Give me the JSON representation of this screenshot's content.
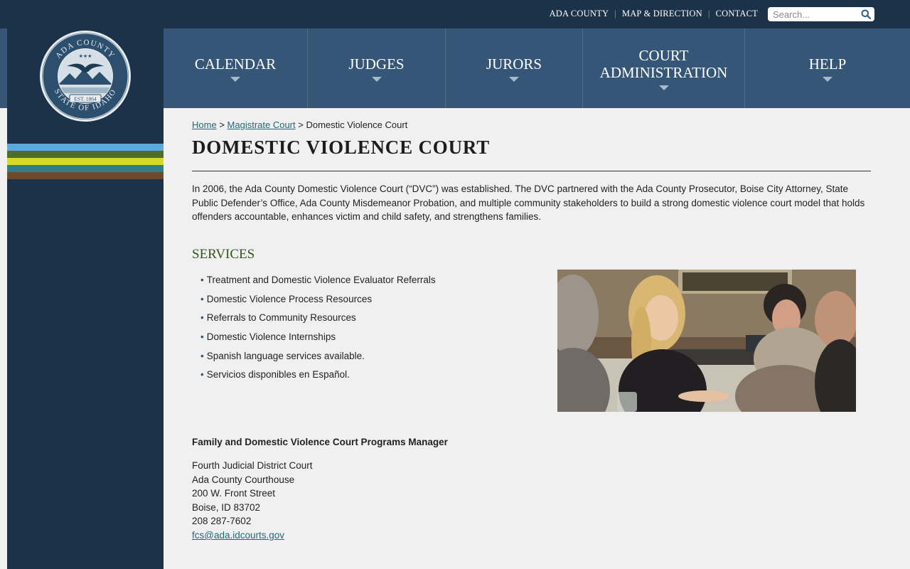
{
  "toplinks": [
    "ADA COUNTY",
    "MAP & DIRECTION",
    "CONTACT"
  ],
  "search": {
    "placeholder": "Search..."
  },
  "seal": {
    "top_text": "ADA COUNTY",
    "bottom_text": "STATE OF IDAHO",
    "est": "EST. 1864",
    "stars": "★★★"
  },
  "stripes": [
    "#5aaadd",
    "#4e6d2c",
    "#d7d92a",
    "#2f7f88",
    "#6e4a2a"
  ],
  "nav": [
    {
      "label": "CALENDAR"
    },
    {
      "label": "JUDGES"
    },
    {
      "label": "JURORS"
    },
    {
      "label": "COURT ADMINISTRATION"
    },
    {
      "label": "HELP"
    }
  ],
  "breadcrumb": {
    "home": "Home",
    "parent": "Magistrate Court",
    "current": "Domestic Violence Court",
    "sep": ">"
  },
  "page_title": "DOMESTIC VIOLENCE COURT",
  "intro": "In 2006, the Ada County Domestic Violence Court (“DVC”) was established. The DVC partnered with the Ada County Prosecutor, Boise City Attorney, State Public Defender’s Office, Ada County Misdemeanor Probation, and multiple community stakeholders to build a strong domestic violence court model that holds offenders accountable, enhances victim and child safety, and strengthens families.",
  "services": {
    "heading": "SERVICES",
    "items": [
      "Treatment and Domestic Violence Evaluator Referrals",
      "Domestic Violence Process Resources",
      "Referrals to Community Resources",
      "Domestic Violence Internships",
      "Spanish language services available.",
      "Servicios disponibles en Español."
    ]
  },
  "contact": {
    "title": "Family and Domestic Violence Court Programs Manager",
    "lines": [
      "Fourth Judicial District Court",
      "Ada County Courthouse",
      "200 W. Front Street",
      "Boise, ID 83702",
      "208 287-7602"
    ],
    "email": "fcs@ada.idcourts.gov"
  }
}
